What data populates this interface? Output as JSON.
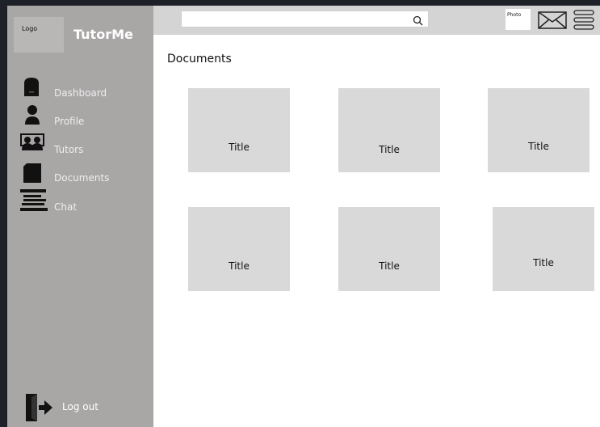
{
  "sidebar": {
    "logo_label": "Logo",
    "brand": "TutorMe",
    "items": [
      {
        "label": "Dashboard",
        "icon": "dashboard-icon"
      },
      {
        "label": "Profile",
        "icon": "profile-icon"
      },
      {
        "label": "Tutors",
        "icon": "tutors-icon"
      },
      {
        "label": "Documents",
        "icon": "documents-icon"
      },
      {
        "label": "Chat",
        "icon": "chat-icon"
      }
    ],
    "logout_label": "Log out"
  },
  "header": {
    "search_value": "",
    "search_icon": "search-icon",
    "photo_label": "Photo",
    "mail_icon": "mail-icon",
    "menu_icon": "menu-icon"
  },
  "main": {
    "title": "Documents",
    "cards": [
      {
        "title": "Title"
      },
      {
        "title": "Title"
      },
      {
        "title": "Title"
      },
      {
        "title": "Title"
      },
      {
        "title": "Title"
      },
      {
        "title": "Title"
      }
    ]
  },
  "colors": {
    "sidebar_bg": "#a9a6a6",
    "topbar_bg": "#d4d4d4",
    "card_bg": "#d9d9d9",
    "outer_bg": "#1e2128"
  }
}
